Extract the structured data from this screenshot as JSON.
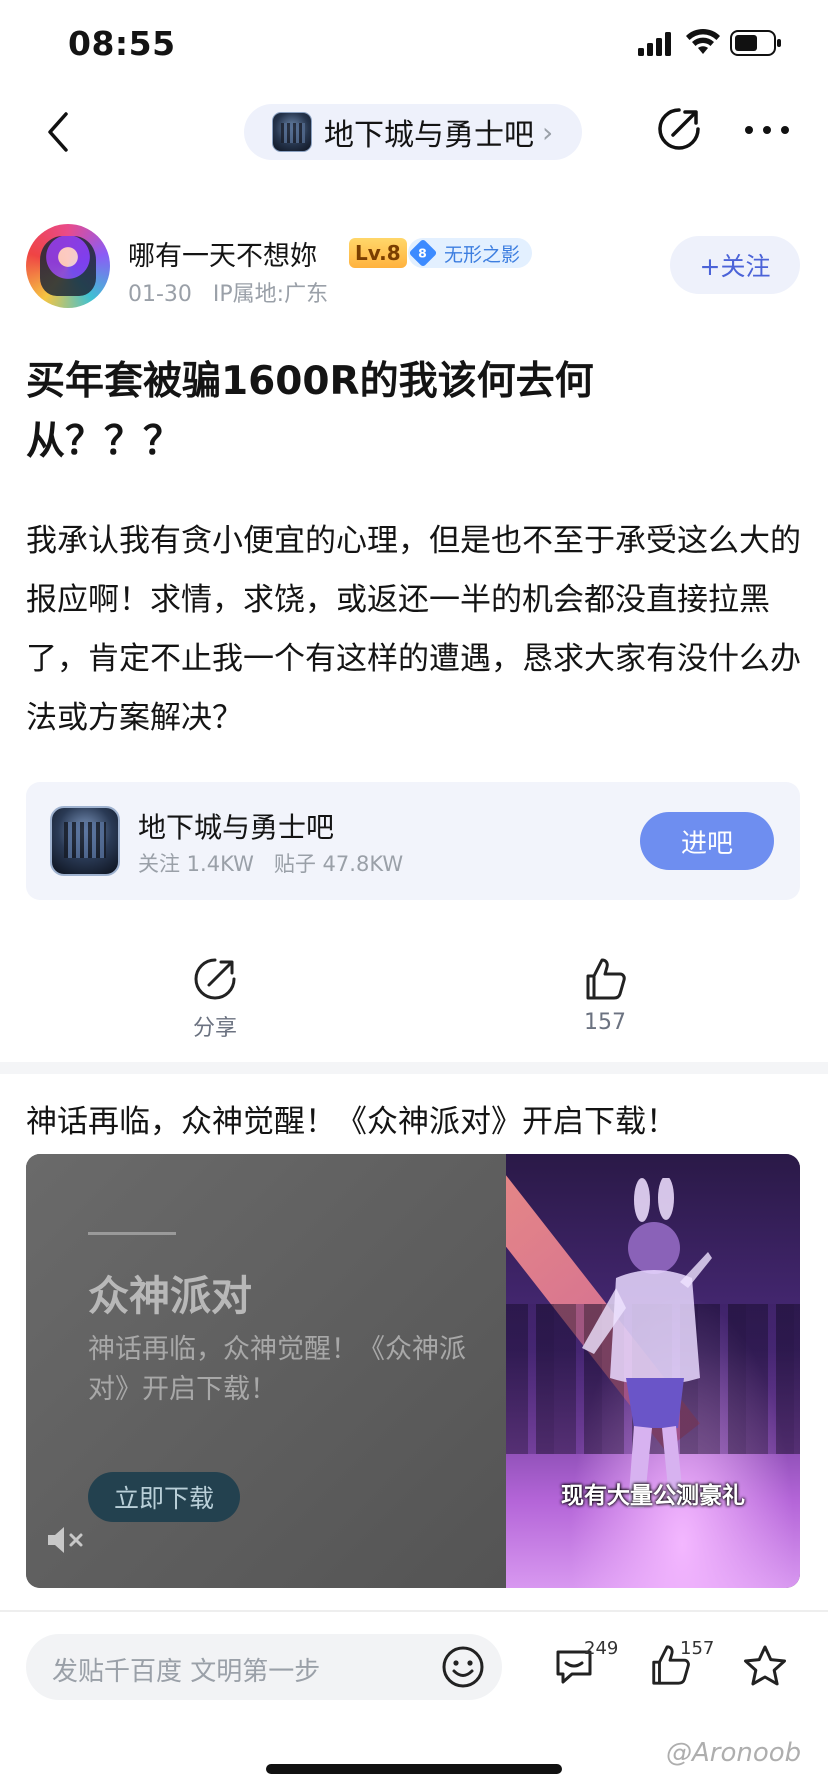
{
  "status_bar": {
    "time": "08:55"
  },
  "nav": {
    "forum_name": "地下城与勇士吧",
    "chevron": "›"
  },
  "author": {
    "name": "哪有一天不想妳",
    "level": "Lv.8",
    "rank_number": "8",
    "rank_title": "无形之影",
    "meta": "01-30   IP属地:广东",
    "follow_label": "+关注"
  },
  "post": {
    "title": "买年套被骗1600R的我该何去何从？？？",
    "body": "我承认我有贪小便宜的心理，但是也不至于承受这么大的报应啊！求情，求饶，或返还一半的机会都没直接拉黑了，肯定不止我一个有这样的遭遇，恳求大家有没什么办法或方案解决？"
  },
  "forum_card": {
    "name": "地下城与勇士吧",
    "stats": "关注 1.4KW   贴子 47.8KW",
    "enter_label": "进吧"
  },
  "actions": {
    "share_label": "分享",
    "like_count": "157"
  },
  "ad": {
    "headline": "神话再临，众神觉醒！《众神派对》开启下载！",
    "title": "众神派对",
    "description": "神话再临，众神觉醒！《众神派对》开启下载！",
    "download_label": "立即下载",
    "video_subtitle": "现有大量公测豪礼"
  },
  "bottom_bar": {
    "comment_placeholder": "发贴千百度 文明第一步",
    "comment_count": "249",
    "like_count": "157"
  },
  "watermark": "@Aronoob",
  "colors": {
    "accent": "#4b63d8",
    "enter_button": "#6e8ef0",
    "level_badge": "#ffb23e",
    "rank_badge": "#3d8bff"
  }
}
